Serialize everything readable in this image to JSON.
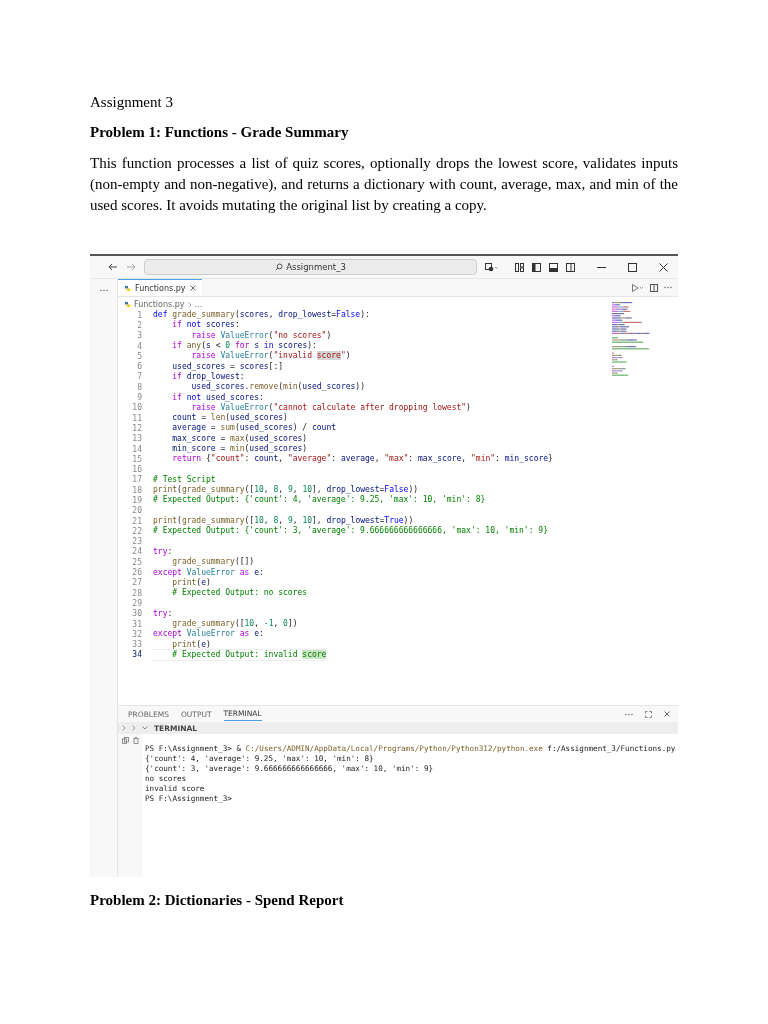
{
  "document": {
    "heading": "Assignment 3",
    "section_title": "Problem 1: Functions - Grade Summary",
    "paragraph": "This function processes a list of quiz scores, optionally drops the lowest score, validates inputs (non-empty and non-negative), and returns a dictionary with count, average, max, and min of the used scores. It avoids mutating the original list by creating a copy.",
    "next_section_title": "Problem 2: Dictionaries - Spend Report"
  },
  "editor": {
    "search": {
      "value": "Assignment_3"
    },
    "tabs": [
      {
        "label": "Functions.py",
        "selected": true
      }
    ],
    "breadcrumb": [
      "Functions.py",
      "..."
    ],
    "code": [
      {
        "number": "1",
        "current": false,
        "tokens": [
          {
            "kind": "kw",
            "text": "def "
          },
          {
            "kind": "fn",
            "text": "grade_summary"
          },
          {
            "kind": "p",
            "text": "("
          },
          {
            "kind": "var",
            "text": "scores"
          },
          {
            "kind": "p",
            "text": ", "
          },
          {
            "kind": "var",
            "text": "drop_lowest"
          },
          {
            "kind": "p",
            "text": "="
          },
          {
            "kind": "kw",
            "text": "False"
          },
          {
            "kind": "p",
            "text": "):"
          }
        ]
      },
      {
        "number": "2",
        "current": false,
        "tokens": [
          {
            "kind": "ctrl",
            "text": "    if "
          },
          {
            "kind": "kw",
            "text": "not "
          },
          {
            "kind": "var",
            "text": "scores"
          },
          {
            "kind": "p",
            "text": ":"
          }
        ]
      },
      {
        "number": "3",
        "current": false,
        "tokens": [
          {
            "kind": "ctrl",
            "text": "        raise "
          },
          {
            "kind": "cls",
            "text": "ValueError"
          },
          {
            "kind": "p",
            "text": "("
          },
          {
            "kind": "str",
            "text": "\"no scores\""
          },
          {
            "kind": "p",
            "text": ")"
          }
        ]
      },
      {
        "number": "4",
        "current": false,
        "tokens": [
          {
            "kind": "ctrl",
            "text": "    if "
          },
          {
            "kind": "fn",
            "text": "any"
          },
          {
            "kind": "p",
            "text": "("
          },
          {
            "kind": "var",
            "text": "s"
          },
          {
            "kind": "p",
            "text": " < "
          },
          {
            "kind": "num",
            "text": "0"
          },
          {
            "kind": "ctrl",
            "text": " for "
          },
          {
            "kind": "var",
            "text": "s"
          },
          {
            "kind": "kw",
            "text": " in "
          },
          {
            "kind": "var",
            "text": "scores"
          },
          {
            "kind": "p",
            "text": "):"
          }
        ]
      },
      {
        "number": "5",
        "current": false,
        "tokens": [
          {
            "kind": "ctrl",
            "text": "        raise "
          },
          {
            "kind": "cls",
            "text": "ValueError"
          },
          {
            "kind": "p",
            "text": "("
          },
          {
            "kind": "str",
            "text": "\"invalid "
          },
          {
            "kind": "match",
            "text": "score"
          },
          {
            "kind": "str",
            "text": "\""
          },
          {
            "kind": "p",
            "text": ")"
          }
        ]
      },
      {
        "number": "6",
        "current": false,
        "tokens": [
          {
            "kind": "var",
            "text": "    used_scores"
          },
          {
            "kind": "p",
            "text": " = "
          },
          {
            "kind": "var",
            "text": "scores"
          },
          {
            "kind": "p",
            "text": "[:]"
          }
        ]
      },
      {
        "number": "7",
        "current": false,
        "tokens": [
          {
            "kind": "ctrl",
            "text": "    if "
          },
          {
            "kind": "var",
            "text": "drop_lowest"
          },
          {
            "kind": "p",
            "text": ":"
          }
        ]
      },
      {
        "number": "8",
        "current": false,
        "tokens": [
          {
            "kind": "var",
            "text": "        used_scores"
          },
          {
            "kind": "p",
            "text": "."
          },
          {
            "kind": "fn",
            "text": "remove"
          },
          {
            "kind": "p",
            "text": "("
          },
          {
            "kind": "fn",
            "text": "min"
          },
          {
            "kind": "p",
            "text": "("
          },
          {
            "kind": "var",
            "text": "used_scores"
          },
          {
            "kind": "p",
            "text": "))"
          }
        ]
      },
      {
        "number": "9",
        "current": false,
        "tokens": [
          {
            "kind": "ctrl",
            "text": "    if "
          },
          {
            "kind": "kw",
            "text": "not "
          },
          {
            "kind": "var",
            "text": "used_scores"
          },
          {
            "kind": "p",
            "text": ":"
          }
        ]
      },
      {
        "number": "10",
        "current": false,
        "tokens": [
          {
            "kind": "ctrl",
            "text": "        raise "
          },
          {
            "kind": "cls",
            "text": "ValueError"
          },
          {
            "kind": "p",
            "text": "("
          },
          {
            "kind": "str",
            "text": "\"cannot calculate after dropping lowest\""
          },
          {
            "kind": "p",
            "text": ")"
          }
        ]
      },
      {
        "number": "11",
        "current": false,
        "tokens": [
          {
            "kind": "var",
            "text": "    count"
          },
          {
            "kind": "p",
            "text": " = "
          },
          {
            "kind": "fn",
            "text": "len"
          },
          {
            "kind": "p",
            "text": "("
          },
          {
            "kind": "var",
            "text": "used_scores"
          },
          {
            "kind": "p",
            "text": ")"
          }
        ]
      },
      {
        "number": "12",
        "current": false,
        "tokens": [
          {
            "kind": "var",
            "text": "    average"
          },
          {
            "kind": "p",
            "text": " = "
          },
          {
            "kind": "fn",
            "text": "sum"
          },
          {
            "kind": "p",
            "text": "("
          },
          {
            "kind": "var",
            "text": "used_scores"
          },
          {
            "kind": "p",
            "text": ") / "
          },
          {
            "kind": "var",
            "text": "count"
          }
        ]
      },
      {
        "number": "13",
        "current": false,
        "tokens": [
          {
            "kind": "var",
            "text": "    max_score"
          },
          {
            "kind": "p",
            "text": " = "
          },
          {
            "kind": "fn",
            "text": "max"
          },
          {
            "kind": "p",
            "text": "("
          },
          {
            "kind": "var",
            "text": "used_scores"
          },
          {
            "kind": "p",
            "text": ")"
          }
        ]
      },
      {
        "number": "14",
        "current": false,
        "tokens": [
          {
            "kind": "var",
            "text": "    min_score"
          },
          {
            "kind": "p",
            "text": " = "
          },
          {
            "kind": "fn",
            "text": "min"
          },
          {
            "kind": "p",
            "text": "("
          },
          {
            "kind": "var",
            "text": "used_scores"
          },
          {
            "kind": "p",
            "text": ")"
          }
        ]
      },
      {
        "number": "15",
        "current": false,
        "tokens": [
          {
            "kind": "ctrl",
            "text": "    return "
          },
          {
            "kind": "p",
            "text": "{"
          },
          {
            "kind": "str",
            "text": "\"count\""
          },
          {
            "kind": "p",
            "text": ": "
          },
          {
            "kind": "var",
            "text": "count"
          },
          {
            "kind": "p",
            "text": ", "
          },
          {
            "kind": "str",
            "text": "\"average\""
          },
          {
            "kind": "p",
            "text": ": "
          },
          {
            "kind": "var",
            "text": "average"
          },
          {
            "kind": "p",
            "text": ", "
          },
          {
            "kind": "str",
            "text": "\"max\""
          },
          {
            "kind": "p",
            "text": ": "
          },
          {
            "kind": "var",
            "text": "max_score"
          },
          {
            "kind": "p",
            "text": ", "
          },
          {
            "kind": "str",
            "text": "\"min\""
          },
          {
            "kind": "p",
            "text": ": "
          },
          {
            "kind": "var",
            "text": "min_score"
          },
          {
            "kind": "p",
            "text": "}"
          }
        ]
      },
      {
        "number": "16",
        "current": false
      },
      {
        "number": "17",
        "current": false,
        "tokens": [
          {
            "kind": "cm",
            "text": "# Test Script"
          }
        ]
      },
      {
        "number": "18",
        "current": false,
        "tokens": [
          {
            "kind": "fn",
            "text": "print"
          },
          {
            "kind": "p",
            "text": "("
          },
          {
            "kind": "fn",
            "text": "grade_summary"
          },
          {
            "kind": "p",
            "text": "(["
          },
          {
            "kind": "num",
            "text": "10"
          },
          {
            "kind": "p",
            "text": ", "
          },
          {
            "kind": "num",
            "text": "8"
          },
          {
            "kind": "p",
            "text": ", "
          },
          {
            "kind": "num",
            "text": "9"
          },
          {
            "kind": "p",
            "text": ", "
          },
          {
            "kind": "num",
            "text": "10"
          },
          {
            "kind": "p",
            "text": "], "
          },
          {
            "kind": "var",
            "text": "drop_lowest"
          },
          {
            "kind": "p",
            "text": "="
          },
          {
            "kind": "kw",
            "text": "False"
          },
          {
            "kind": "p",
            "text": "))"
          }
        ]
      },
      {
        "number": "19",
        "current": false,
        "tokens": [
          {
            "kind": "cm",
            "text": "# Expected Output: {'count': 4, 'average': 9.25, 'max': 10, 'min': 8}"
          }
        ]
      },
      {
        "number": "20",
        "current": false
      },
      {
        "number": "21",
        "current": false,
        "tokens": [
          {
            "kind": "fn",
            "text": "print"
          },
          {
            "kind": "p",
            "text": "("
          },
          {
            "kind": "fn",
            "text": "grade_summary"
          },
          {
            "kind": "p",
            "text": "(["
          },
          {
            "kind": "num",
            "text": "10"
          },
          {
            "kind": "p",
            "text": ", "
          },
          {
            "kind": "num",
            "text": "8"
          },
          {
            "kind": "p",
            "text": ", "
          },
          {
            "kind": "num",
            "text": "9"
          },
          {
            "kind": "p",
            "text": ", "
          },
          {
            "kind": "num",
            "text": "10"
          },
          {
            "kind": "p",
            "text": "], "
          },
          {
            "kind": "var",
            "text": "drop_lowest"
          },
          {
            "kind": "p",
            "text": "="
          },
          {
            "kind": "kw",
            "text": "True"
          },
          {
            "kind": "p",
            "text": "))"
          }
        ]
      },
      {
        "number": "22",
        "current": false,
        "tokens": [
          {
            "kind": "cm",
            "text": "# Expected Output: {'count': 3, 'average': 9.666666666666666, 'max': 10, 'min': 9}"
          }
        ]
      },
      {
        "number": "23",
        "current": false
      },
      {
        "number": "24",
        "current": false,
        "tokens": [
          {
            "kind": "ctrl",
            "text": "try"
          },
          {
            "kind": "p",
            "text": ":"
          }
        ]
      },
      {
        "number": "25",
        "current": false,
        "tokens": [
          {
            "kind": "fn",
            "text": "    grade_summary"
          },
          {
            "kind": "p",
            "text": "([])"
          }
        ]
      },
      {
        "number": "26",
        "current": false,
        "tokens": [
          {
            "kind": "ctrl",
            "text": "except "
          },
          {
            "kind": "cls",
            "text": "ValueError"
          },
          {
            "kind": "ctrl",
            "text": " as "
          },
          {
            "kind": "var",
            "text": "e"
          },
          {
            "kind": "p",
            "text": ":"
          }
        ]
      },
      {
        "number": "27",
        "current": false,
        "tokens": [
          {
            "kind": "fn",
            "text": "    print"
          },
          {
            "kind": "p",
            "text": "("
          },
          {
            "kind": "var",
            "text": "e"
          },
          {
            "kind": "p",
            "text": ")"
          }
        ]
      },
      {
        "number": "28",
        "current": false,
        "tokens": [
          {
            "kind": "cm",
            "text": "    # Expected Output: no scores"
          }
        ]
      },
      {
        "number": "29",
        "current": false
      },
      {
        "number": "30",
        "current": false,
        "tokens": [
          {
            "kind": "ctrl",
            "text": "try"
          },
          {
            "kind": "p",
            "text": ":"
          }
        ]
      },
      {
        "number": "31",
        "current": false,
        "tokens": [
          {
            "kind": "fn",
            "text": "    grade_summary"
          },
          {
            "kind": "p",
            "text": "(["
          },
          {
            "kind": "num",
            "text": "10"
          },
          {
            "kind": "p",
            "text": ", "
          },
          {
            "kind": "num",
            "text": "-1"
          },
          {
            "kind": "p",
            "text": ", "
          },
          {
            "kind": "num",
            "text": "0"
          },
          {
            "kind": "p",
            "text": "])"
          }
        ]
      },
      {
        "number": "32",
        "current": false,
        "tokens": [
          {
            "kind": "ctrl",
            "text": "except "
          },
          {
            "kind": "cls",
            "text": "ValueError"
          },
          {
            "kind": "ctrl",
            "text": " as "
          },
          {
            "kind": "var",
            "text": "e"
          },
          {
            "kind": "p",
            "text": ":"
          }
        ]
      },
      {
        "number": "33",
        "current": false,
        "tokens": [
          {
            "kind": "fn",
            "text": "    print"
          },
          {
            "kind": "p",
            "text": "("
          },
          {
            "kind": "var",
            "text": "e"
          },
          {
            "kind": "p",
            "text": ")"
          }
        ]
      },
      {
        "number": "34",
        "current": true,
        "tokens": [
          {
            "kind": "cm",
            "text": "    # Expected Output: invalid "
          },
          {
            "kind": "cmatch",
            "text": "score"
          }
        ]
      }
    ],
    "panel_tabs": [
      {
        "label": "PROBLEMS",
        "selected": false
      },
      {
        "label": "OUTPUT",
        "selected": false
      },
      {
        "label": "TERMINAL",
        "selected": true
      }
    ],
    "terminal_header": "TERMINAL",
    "terminal": [
      [
        {
          "kind": "p",
          "text": "PS F:\\Assignment_3> & "
        },
        {
          "kind": "fn",
          "text": "C:/Users/ADMIN/AppData/Local/Programs/Python/Python312/python.exe"
        },
        {
          "kind": "p",
          "text": " f:/Assignment_3/Functions.py"
        }
      ],
      [
        {
          "kind": "p",
          "text": "{'count': 4, 'average': 9.25, 'max': 10, 'min': 8}"
        }
      ],
      [
        {
          "kind": "p",
          "text": "{'count': 3, 'average': 9.666666666666666, 'max': 10, 'min': 9}"
        }
      ],
      [
        {
          "kind": "p",
          "text": "no scores"
        }
      ],
      [
        {
          "kind": "p",
          "text": "invalid score"
        }
      ],
      [
        {
          "kind": "p",
          "text": "PS F:\\Assignment_3>"
        }
      ]
    ]
  }
}
